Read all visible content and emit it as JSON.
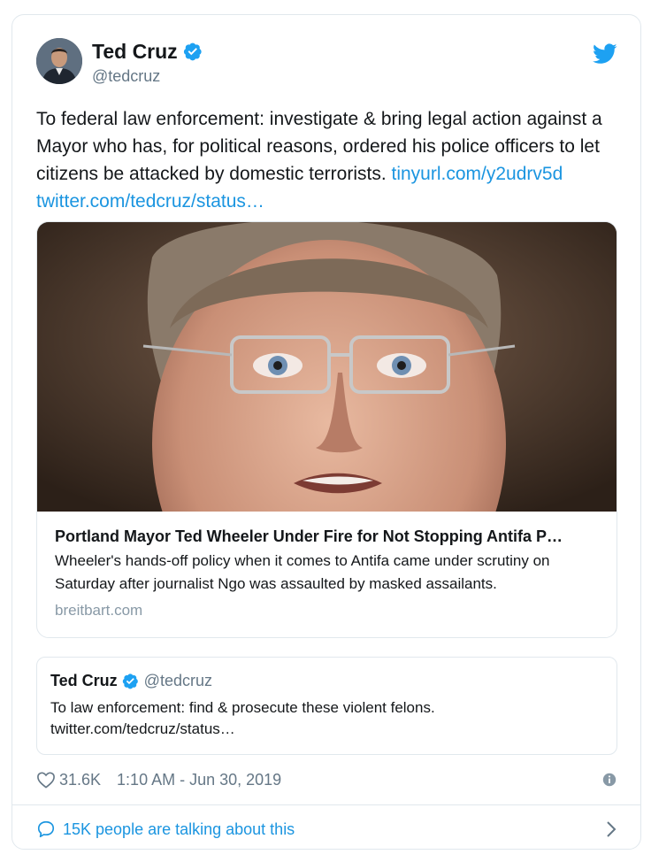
{
  "author": {
    "name": "Ted Cruz",
    "handle": "@tedcruz"
  },
  "tweet": {
    "text_main": "To federal law enforcement:  investigate & bring legal action against a Mayor who has, for political reasons, ordered his police officers to let citizens be attacked by domestic terrorists. ",
    "link1": "tinyurl.com/y2udrv5d",
    "link2": "twitter.com/tedcruz/status…"
  },
  "link_card": {
    "title": "Portland Mayor Ted Wheeler Under Fire for Not Stopping Antifa P…",
    "description": "Wheeler's hands-off policy when it comes to Antifa came under scrutiny on Saturday after journalist Ngo was assaulted by masked assailants.",
    "domain": "breitbart.com"
  },
  "quote": {
    "name": "Ted Cruz",
    "handle": "@tedcruz",
    "text": "To law enforcement:  find & prosecute these violent felons.",
    "link": "twitter.com/tedcruz/status…"
  },
  "meta": {
    "likes": "31.6K",
    "timestamp": "1:10 AM - Jun 30, 2019"
  },
  "talking": {
    "label": "15K people are talking about this"
  },
  "colors": {
    "accent": "#1b95e0",
    "verified": "#1da1f2",
    "secondary_text": "#657786",
    "border": "#e1e8ed"
  },
  "icons": [
    "verified-badge-icon",
    "twitter-bird-icon",
    "heart-icon",
    "info-icon",
    "speech-bubble-icon",
    "chevron-right-icon"
  ]
}
